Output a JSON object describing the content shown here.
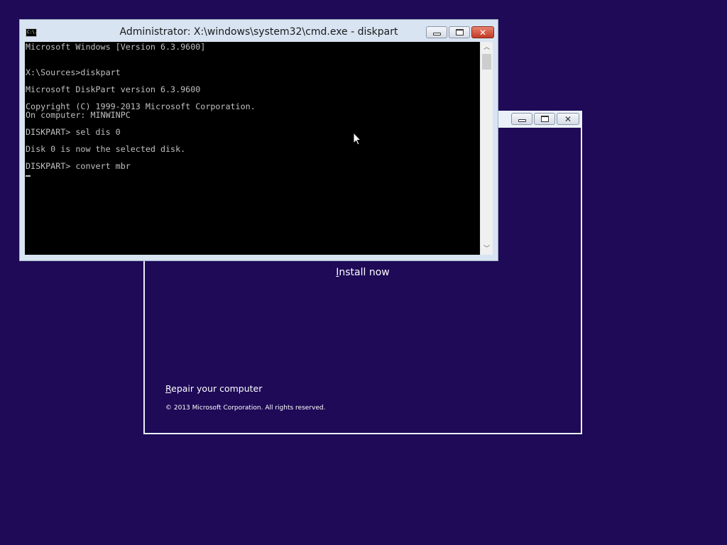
{
  "cmd_window": {
    "title": "Administrator: X:\\windows\\system32\\cmd.exe - diskpart",
    "icon_text": "C:\\.",
    "console_lines": [
      "Microsoft Windows [Version 6.3.9600]",
      "",
      "",
      "X:\\Sources>diskpart",
      "",
      "Microsoft DiskPart version 6.3.9600",
      "",
      "Copyright (C) 1999-2013 Microsoft Corporation.",
      "On computer: MINWINPC",
      "",
      "DISKPART> sel dis 0",
      "",
      "Disk 0 is now the selected disk.",
      "",
      "DISKPART> convert mbr"
    ],
    "icons": {
      "system": "cmd-system-icon",
      "minimize": "minimize-icon",
      "maximize": "maximize-icon",
      "close": "close-icon",
      "scroll_up": "chevron-up-icon",
      "scroll_down": "chevron-down-icon"
    }
  },
  "setup_window": {
    "install_label": "Install now",
    "repair_label": "Repair your computer",
    "copyright": "© 2013 Microsoft Corporation. All rights reserved."
  },
  "colors": {
    "desktop_background": "#1e0a57",
    "console_background": "#000000",
    "console_text": "#c0c0c0",
    "close_button": "#c13a26"
  }
}
